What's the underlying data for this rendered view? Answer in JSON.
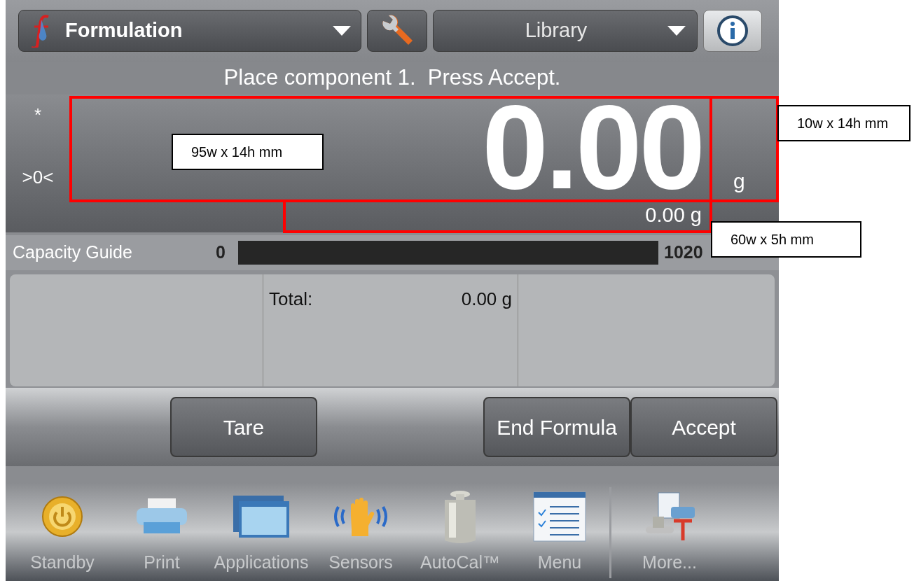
{
  "header": {
    "mode_selector": "Formulation",
    "library_selector": "Library"
  },
  "message": "Place component 1.  Press Accept.",
  "indicators": [
    "*",
    ">0<"
  ],
  "weight": {
    "value": "0.00",
    "unit": "g",
    "secondary": "0.00 g"
  },
  "capacity_guide": {
    "label": "Capacity Guide",
    "min": "0",
    "max": "1020"
  },
  "info_panel": {
    "total_label": "Total:",
    "total_value": "0.00 g"
  },
  "buttons": [
    "Tare",
    "End Formula",
    "Accept"
  ],
  "nav": [
    {
      "label": "Standby",
      "kind": "standby"
    },
    {
      "label": "Print",
      "kind": "print"
    },
    {
      "label": "Applications",
      "kind": "applications"
    },
    {
      "label": "Sensors",
      "kind": "sensors"
    },
    {
      "label": "AutoCal™",
      "kind": "autocal"
    },
    {
      "label": "Menu",
      "kind": "menu"
    },
    {
      "label": "More...",
      "kind": "more"
    }
  ],
  "annotations": [
    "95w x 14h mm",
    "10w x 14h mm",
    "60w x 5h mm"
  ]
}
